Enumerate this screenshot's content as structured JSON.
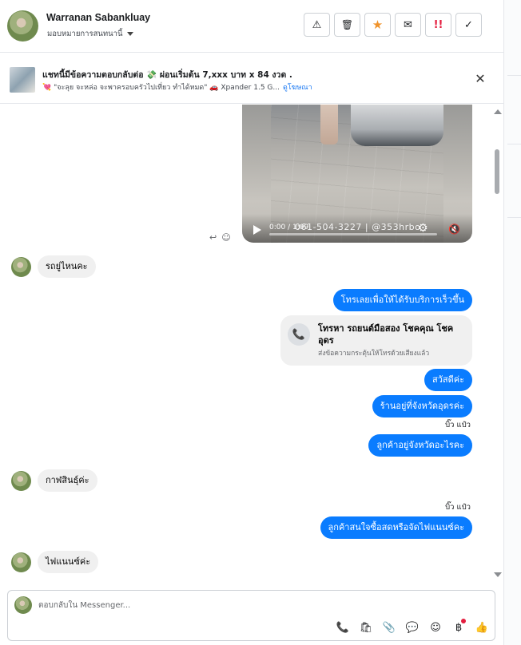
{
  "header": {
    "name": "Warranan Sabankluay",
    "assign_label": "มอบหมายการสนทนานี้",
    "actions": [
      {
        "icon": "warning-icon",
        "glyph": "⚠"
      },
      {
        "icon": "trash-icon",
        "glyph": "🗑"
      },
      {
        "icon": "star-icon",
        "glyph": "★",
        "color": "#f0932b"
      },
      {
        "icon": "envelope-open-icon",
        "glyph": "✉"
      },
      {
        "icon": "priority-icon",
        "glyph": "!!",
        "color": "#e41e3f"
      },
      {
        "icon": "checkmark-icon",
        "glyph": "✓"
      }
    ]
  },
  "ad": {
    "title": "แชทนี้มีข้อความตอบกลับต่อ 💸 ผ่อนเริ่มต้น 7,xxx บาท x 84 งวด .",
    "subtitle": "💘 \"จะลุย จะหล่อ จะพาครอบครัวไปเที่ยว ทำได้หมด\" 🚗 Xpander 1.5 G...",
    "link": "ดูโฆษณา"
  },
  "video": {
    "time": "0:00 / 1:09",
    "overlay_text": "061-504-3227 | @353hrbo"
  },
  "messages": {
    "in1": "รถยู่ไหนคะ",
    "out1": "โทรเลยเพื่อให้ได้รับบริการเร็วขึ้น",
    "call_card_title": "โทรหา รถยนต์มือสอง โชคคุณ โชค อุดร",
    "call_card_sub": "ส่งข้อความกระตุ้นให้โทรด้วยเสียงแล้ว",
    "out2": "สวัสดีค่ะ",
    "out3": "ร้านอยู่ที่จังหวัดอุดรค่ะ",
    "seen1": "บิ๊ว แป๋ว",
    "out4": "ลูกค้าอยู่จังหวัดอะไรคะ",
    "in2": "กาฬสินธุ์ค่ะ",
    "seen2": "บิ๊ว แป๋ว",
    "out5": "ลูกค้าสนใจซื้อสดหรือจัดไฟแนนซ์คะ",
    "in3": "ไฟแนนซ์ค่ะ"
  },
  "composer": {
    "placeholder": "ตอบกลับใน Messenger..."
  },
  "colors": {
    "accent": "#0a7cff",
    "incoming_bubble": "#f0f0f0",
    "link": "#1877f2"
  }
}
